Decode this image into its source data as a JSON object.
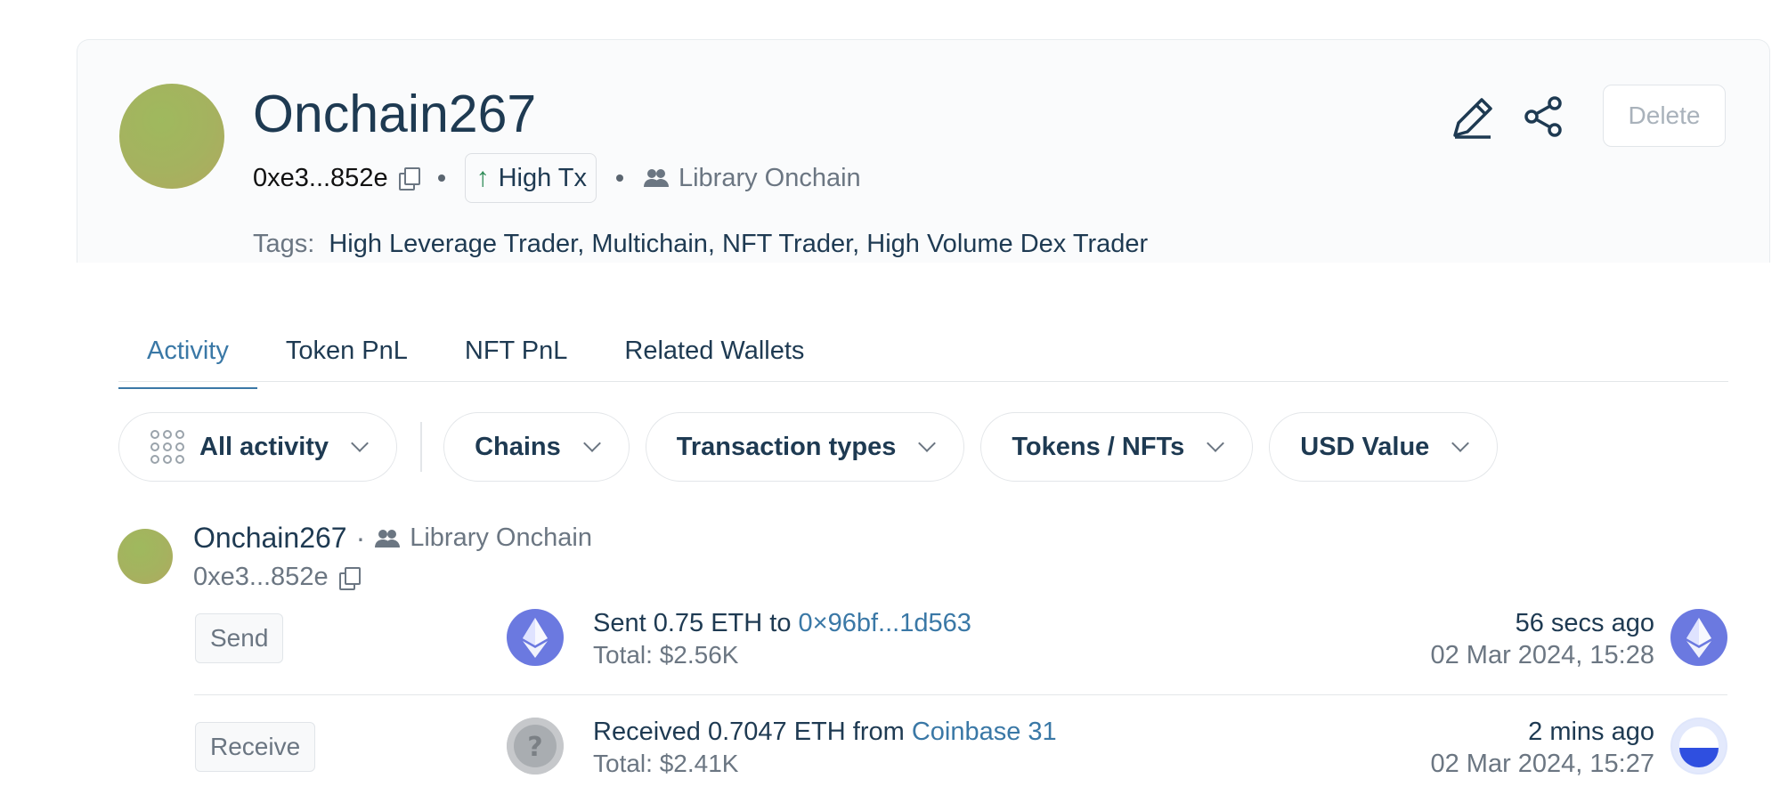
{
  "profile": {
    "name": "Onchain267",
    "address": "0xe3...852e",
    "badge": "High Tx",
    "source": "Library Onchain",
    "tags_label": "Tags:",
    "tags": "High Leverage Trader, Multichain, NFT Trader, High Volume Dex Trader",
    "delete_label": "Delete"
  },
  "tabs": [
    {
      "label": "Activity",
      "active": true
    },
    {
      "label": "Token PnL"
    },
    {
      "label": "NFT PnL"
    },
    {
      "label": "Related Wallets"
    }
  ],
  "filters": {
    "activity": "All activity",
    "chains": "Chains",
    "tx_types": "Transaction types",
    "tokens": "Tokens / NFTs",
    "usd": "USD Value"
  },
  "feed": {
    "account_name": "Onchain267",
    "separator": "·",
    "account_source": "Library Onchain",
    "account_address": "0xe3...852e",
    "transactions": [
      {
        "type": "Send",
        "coin_icon": "eth-icon",
        "text": "Sent 0.75 ETH to",
        "counterparty": "0×96bf...1d563",
        "total": "Total: $2.56K",
        "time_ago": "56 secs ago",
        "datetime": "02 Mar 2024, 15:28",
        "chain_icon": "ethereum-chain-icon"
      },
      {
        "type": "Receive",
        "coin_icon": "unknown-token-icon",
        "text": "Received 0.7047 ETH from",
        "counterparty": "Coinbase 31",
        "total": "Total: $2.41K",
        "time_ago": "2 mins ago",
        "datetime": "02 Mar 2024, 15:27",
        "chain_icon": "base-chain-icon"
      }
    ]
  },
  "colors": {
    "accent": "#3a78a6",
    "text": "#1e3a52",
    "muted": "#6b7682",
    "up_arrow": "#2e8b57",
    "eth": "#6b79e0"
  }
}
